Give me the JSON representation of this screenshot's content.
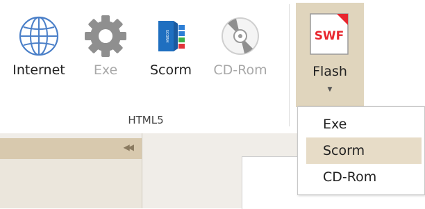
{
  "ribbon": {
    "group_label": "HTML5",
    "buttons": [
      {
        "label": "Internet",
        "icon": "globe-icon",
        "enabled": true
      },
      {
        "label": "Exe",
        "icon": "gear-icon",
        "enabled": false
      },
      {
        "label": "Scorm",
        "icon": "scorm-package-icon",
        "enabled": true
      },
      {
        "label": "CD-Rom",
        "icon": "cd-rom-icon",
        "enabled": false
      }
    ],
    "flash": {
      "label": "Flash",
      "icon": "swf-file-icon",
      "icon_text": "SWF",
      "pressed": true
    }
  },
  "dropdown": {
    "items": [
      {
        "label": "Exe",
        "highlighted": false
      },
      {
        "label": "Scorm",
        "highlighted": true
      },
      {
        "label": "CD-Rom",
        "highlighted": false
      }
    ]
  },
  "colors": {
    "pressed_bg": "#e0d5bd",
    "menu_highlight": "#e7dcc7",
    "pane_header": "#d8c9ae",
    "swf_red": "#e8262e",
    "globe_blue": "#4a7fc8",
    "scorm_blue": "#1f6fc0",
    "disabled_text": "#a8a8a8"
  }
}
